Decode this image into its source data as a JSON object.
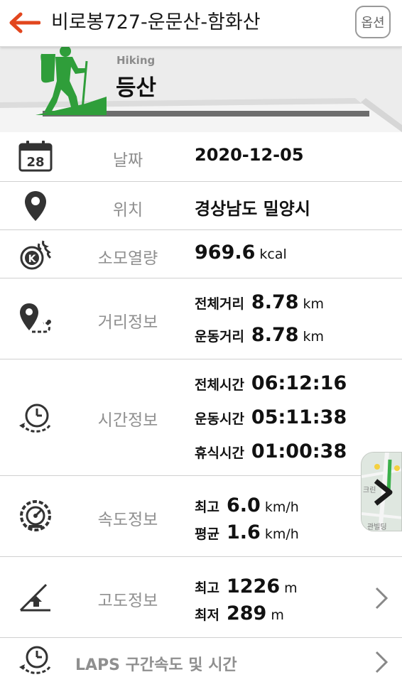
{
  "header": {
    "title": "비로봉727-운문산-함화산",
    "option_label": "옵션"
  },
  "banner": {
    "sport_en": "Hiking",
    "sport_kr": "등산"
  },
  "date": {
    "calendar_day": "28",
    "label": "날짜",
    "value": "2020-12-05"
  },
  "location": {
    "label": "위치",
    "value": "경상남도 밀양시"
  },
  "calories": {
    "icon_letter": "K",
    "label": "소모열량",
    "value": "969.6",
    "unit": "kcal"
  },
  "distance": {
    "label": "거리정보",
    "items": [
      {
        "key": "전체거리",
        "value": "8.78",
        "unit": "km"
      },
      {
        "key": "운동거리",
        "value": "8.78",
        "unit": "km"
      }
    ]
  },
  "time": {
    "label": "시간정보",
    "items": [
      {
        "key": "전체시간",
        "value": "06:12:16"
      },
      {
        "key": "운동시간",
        "value": "05:11:38"
      },
      {
        "key": "휴식시간",
        "value": "01:00:38"
      }
    ]
  },
  "speed": {
    "label": "속도정보",
    "items": [
      {
        "key": "최고",
        "value": "6.0",
        "unit": "km/h"
      },
      {
        "key": "평균",
        "value": "1.6",
        "unit": "km/h"
      }
    ]
  },
  "altitude": {
    "label": "고도정보",
    "items": [
      {
        "key": "최고",
        "value": "1226",
        "unit": "m"
      },
      {
        "key": "최저",
        "value": "289",
        "unit": "m"
      }
    ]
  },
  "laps": {
    "label": "LAPS 구간속도 및 시간"
  },
  "map_thumb": {
    "text_top": "크린",
    "text_bottom": "관빌딩"
  },
  "colors": {
    "accent": "#e2461e",
    "hiker_green": "#2f9e3a",
    "label_gray": "#8f8f8f"
  }
}
